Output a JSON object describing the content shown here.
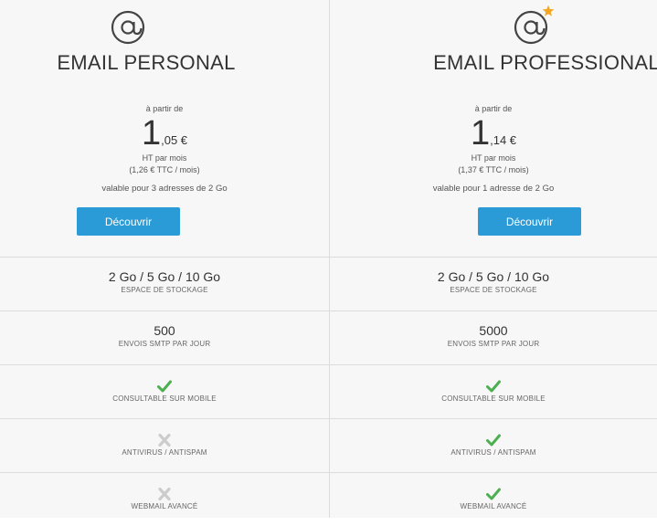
{
  "colors": {
    "accent_button": "#2a9bd6",
    "check": "#4caf50",
    "cross": "#cccccc",
    "star": "#f5a623"
  },
  "plans": [
    {
      "title": "EMAIL PERSONAL",
      "from_label": "à partir de",
      "price_main": "1",
      "price_cents": ",05 €",
      "ht_label": "HT par mois",
      "ttc_label": "(1,26 € TTC / mois)",
      "valid_label": "valable pour 3 adresses de 2 Go",
      "cta_label": "Découvrir",
      "features": {
        "storage_value": "2 Go / 5 Go / 10 Go",
        "storage_label": "ESPACE DE STOCKAGE",
        "smtp_value": "500",
        "smtp_label": "ENVOIS SMTP PAR JOUR",
        "mobile_label": "CONSULTABLE SUR MOBILE",
        "mobile_icon": "check-icon",
        "antivirus_label": "ANTIVIRUS / ANTISPAM",
        "antivirus_icon": "cross-icon",
        "webmail_label": "WEBMAIL AVANCÉ",
        "webmail_icon": "cross-icon"
      }
    },
    {
      "title": "EMAIL PROFESSIONAL",
      "from_label": "à partir de",
      "price_main": "1",
      "price_cents": ",14 €",
      "ht_label": "HT par mois",
      "ttc_label": "(1,37 € TTC / mois)",
      "valid_label": "valable pour 1 adresse de 2 Go",
      "cta_label": "Découvrir",
      "features": {
        "storage_value": "2 Go / 5 Go / 10 Go",
        "storage_label": "ESPACE DE STOCKAGE",
        "smtp_value": "5000",
        "smtp_label": "ENVOIS SMTP PAR JOUR",
        "mobile_label": "CONSULTABLE SUR MOBILE",
        "mobile_icon": "check-icon",
        "antivirus_label": "ANTIVIRUS / ANTISPAM",
        "antivirus_icon": "check-icon",
        "webmail_label": "WEBMAIL AVANCÉ",
        "webmail_icon": "check-icon"
      }
    }
  ]
}
